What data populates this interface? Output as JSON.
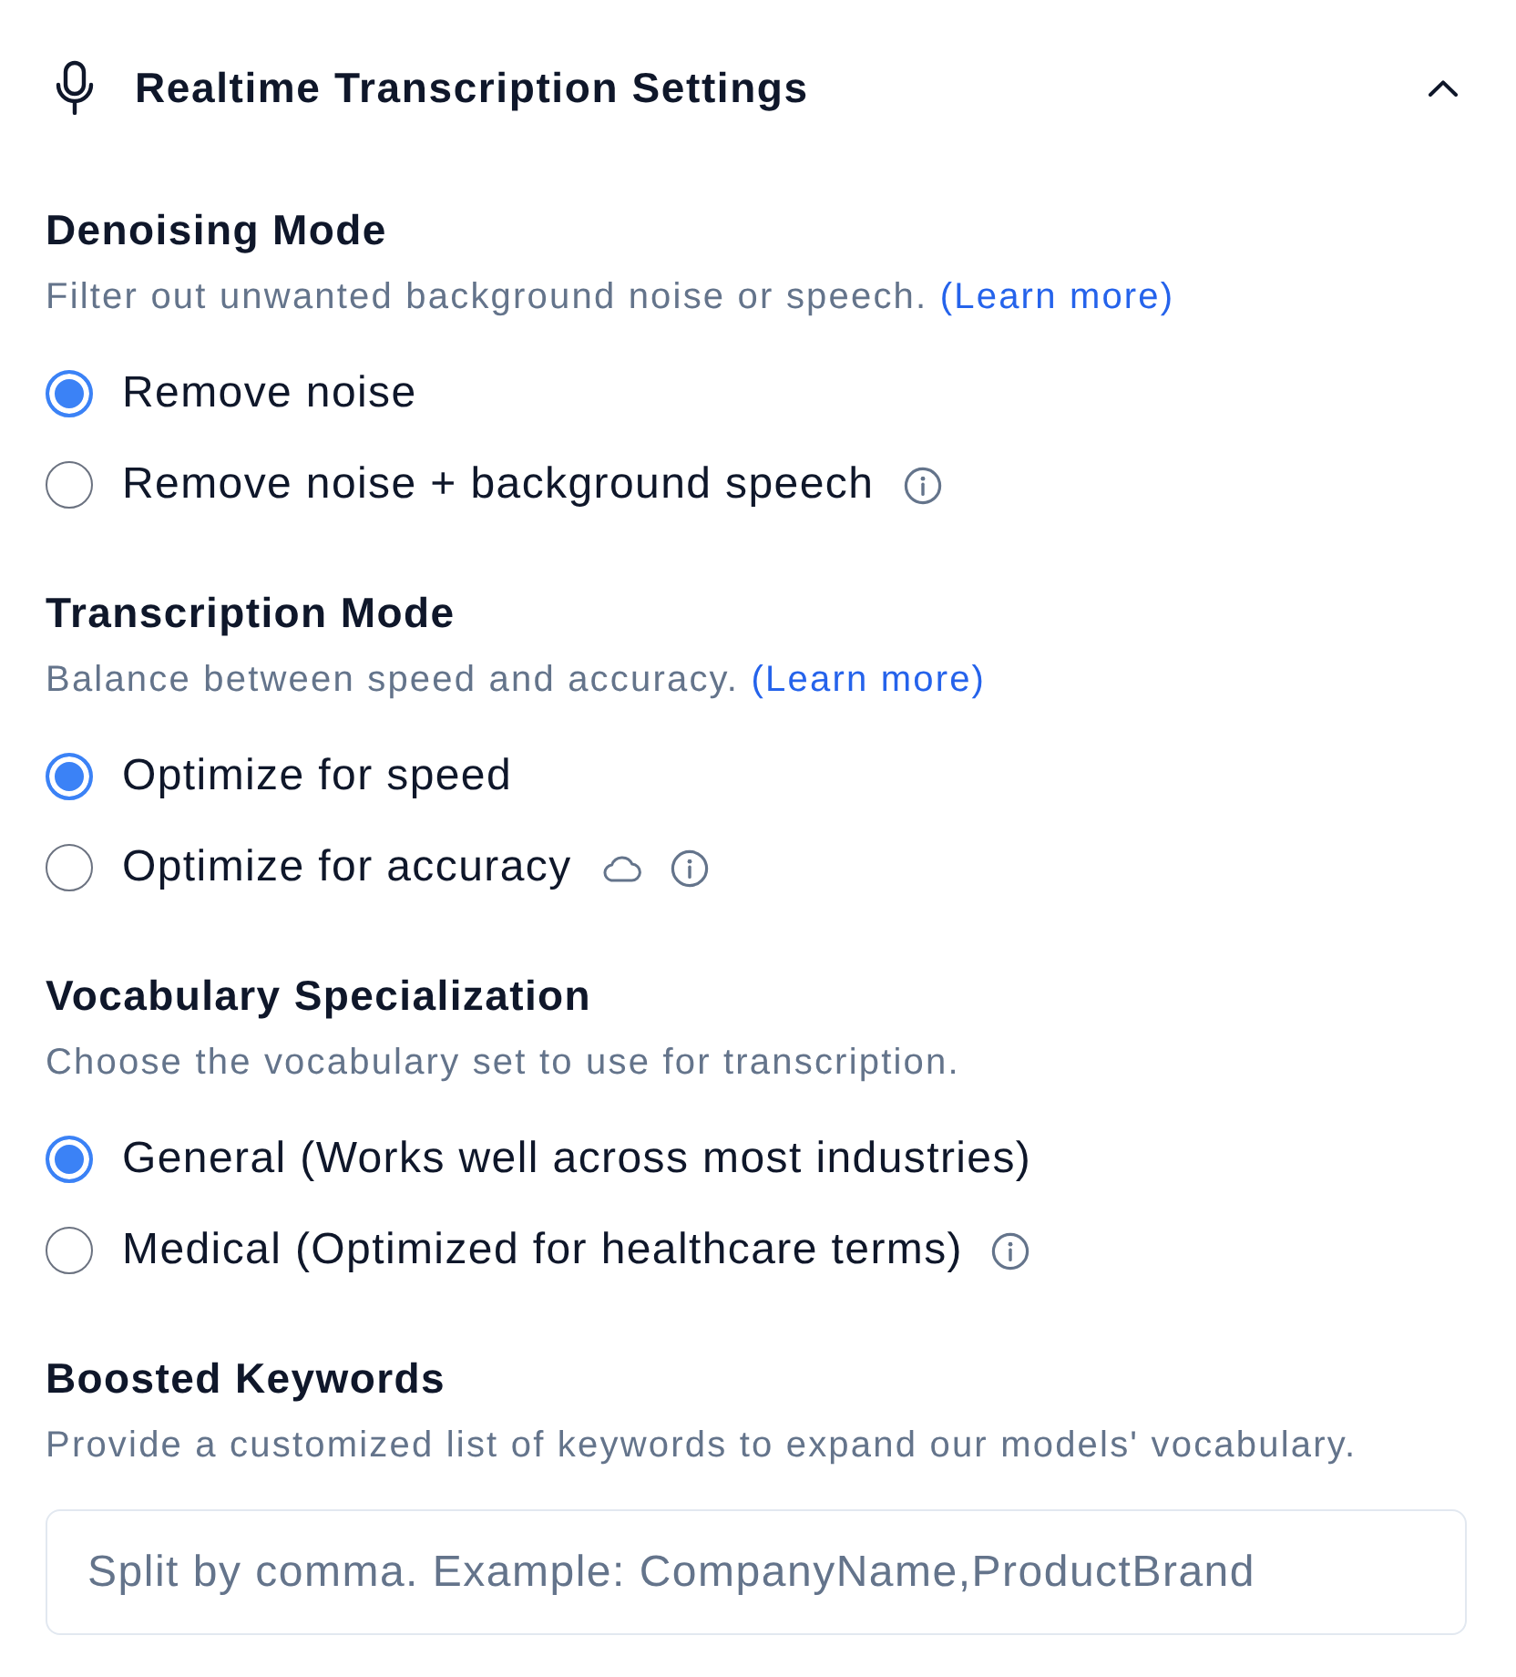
{
  "header": {
    "title": "Realtime Transcription Settings",
    "expanded": true
  },
  "sections": [
    {
      "kind": "radio",
      "title": "Denoising Mode",
      "description": "Filter out unwanted background noise or speech.",
      "link": "(Learn more)",
      "options": [
        {
          "label": "Remove noise",
          "selected": true
        },
        {
          "label": "Remove noise + background speech",
          "selected": false,
          "info": true
        }
      ]
    },
    {
      "kind": "radio",
      "title": "Transcription Mode",
      "description": "Balance between speed and accuracy.",
      "link": "(Learn more)",
      "options": [
        {
          "label": "Optimize for speed",
          "selected": true
        },
        {
          "label": "Optimize for accuracy",
          "selected": false,
          "cloud": true,
          "info": true
        }
      ]
    },
    {
      "kind": "radio",
      "title": "Vocabulary Specialization",
      "description": "Choose the vocabulary set to use for transcription.",
      "options": [
        {
          "label": "General (Works well across most industries)",
          "selected": true
        },
        {
          "label": "Medical (Optimized for healthcare terms)",
          "selected": false,
          "info": true
        }
      ]
    },
    {
      "kind": "input",
      "title": "Boosted Keywords",
      "description": "Provide a customized list of keywords to expand our models' vocabulary.",
      "placeholder": "Split by comma. Example: CompanyName,ProductBrand"
    }
  ]
}
